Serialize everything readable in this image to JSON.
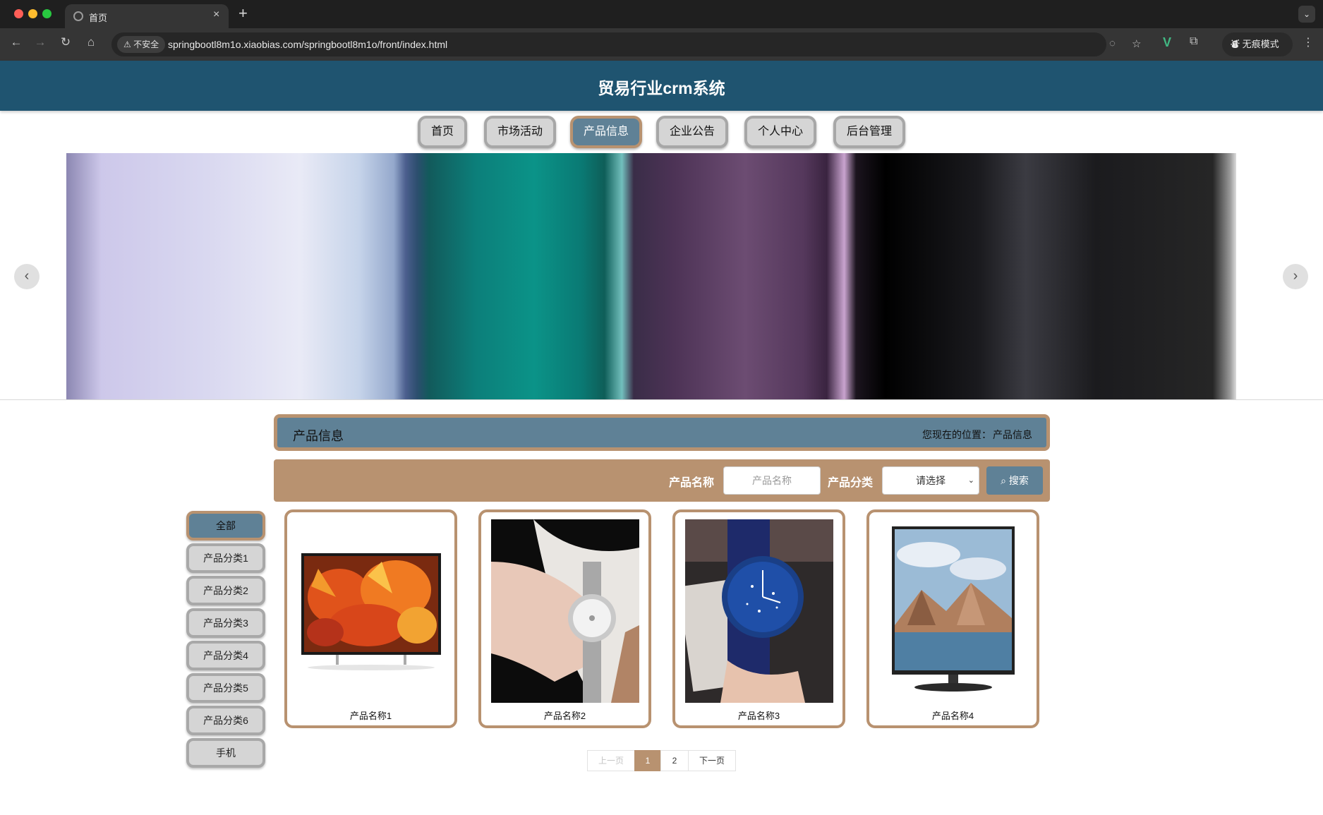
{
  "browser": {
    "tab_title": "首页",
    "insecure_label": "不安全",
    "url": "springbootl8m1o.xiaobias.com/springbootl8m1o/front/index.html",
    "incognito_label": "无痕模式"
  },
  "site": {
    "title": "贸易行业crm系统"
  },
  "menu": {
    "items": [
      "首页",
      "市场活动",
      "产品信息",
      "企业公告",
      "个人中心",
      "后台管理"
    ],
    "active": "产品信息"
  },
  "breadcrumb": {
    "title": "产品信息",
    "location_label": "您现在的位置：",
    "location_value": "产品信息"
  },
  "search": {
    "name_label": "产品名称",
    "name_placeholder": "产品名称",
    "category_label": "产品分类",
    "category_selected": "请选择",
    "button_label": "搜索"
  },
  "categories": {
    "items": [
      "全部",
      "产品分类1",
      "产品分类2",
      "产品分类3",
      "产品分类4",
      "产品分类5",
      "产品分类6",
      "手机"
    ],
    "active": "全部"
  },
  "products": [
    {
      "name": "产品名称1",
      "image": "tv-flowers"
    },
    {
      "name": "产品名称2",
      "image": "silver-watch-on-wrist"
    },
    {
      "name": "产品名称3",
      "image": "blue-starry-watch"
    },
    {
      "name": "产品名称4",
      "image": "monitor-mountain-lake"
    }
  ],
  "pagination": {
    "prev": "上一页",
    "pages": [
      "1",
      "2"
    ],
    "current": "1",
    "next": "下一页"
  }
}
